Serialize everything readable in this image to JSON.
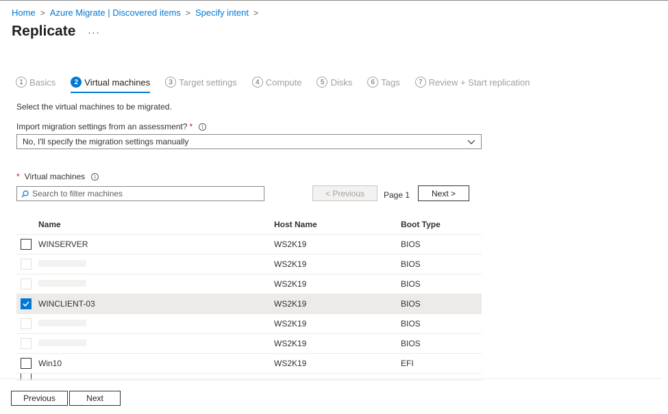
{
  "breadcrumb": [
    "Home",
    "Azure Migrate | Discovered items",
    "Specify intent"
  ],
  "title": "Replicate",
  "more_label": "···",
  "steps": [
    {
      "num": "1",
      "label": "Basics",
      "active": false
    },
    {
      "num": "2",
      "label": "Virtual machines",
      "active": true
    },
    {
      "num": "3",
      "label": "Target settings",
      "active": false
    },
    {
      "num": "4",
      "label": "Compute",
      "active": false
    },
    {
      "num": "5",
      "label": "Disks",
      "active": false
    },
    {
      "num": "6",
      "label": "Tags",
      "active": false
    },
    {
      "num": "7",
      "label": "Review + Start replication",
      "active": false
    }
  ],
  "description": "Select the virtual machines to be migrated.",
  "import_label": "Import migration settings from an assessment?",
  "required_mark": "*",
  "info_glyph": "i",
  "import_value": "No, I'll specify the migration settings manually",
  "vm_label": "Virtual machines",
  "search_placeholder": "Search to filter machines",
  "pager": {
    "previous": "< Previous",
    "page": "Page 1",
    "next": "Next >"
  },
  "table": {
    "headers": {
      "name": "Name",
      "host": "Host Name",
      "boot": "Boot Type"
    },
    "rows": [
      {
        "name": "WINSERVER",
        "host": "WS2K19",
        "boot": "BIOS",
        "checked": false,
        "blurred": false
      },
      {
        "name": "",
        "host": "WS2K19",
        "boot": "BIOS",
        "checked": false,
        "blurred": true
      },
      {
        "name": "",
        "host": "WS2K19",
        "boot": "BIOS",
        "checked": false,
        "blurred": true
      },
      {
        "name": "WINCLIENT-03",
        "host": "WS2K19",
        "boot": "BIOS",
        "checked": true,
        "blurred": false
      },
      {
        "name": "",
        "host": "WS2K19",
        "boot": "BIOS",
        "checked": false,
        "blurred": true
      },
      {
        "name": "",
        "host": "WS2K19",
        "boot": "BIOS",
        "checked": false,
        "blurred": true
      },
      {
        "name": "Win10",
        "host": "WS2K19",
        "boot": "EFI",
        "checked": false,
        "blurred": false
      }
    ]
  },
  "footer": {
    "previous": "Previous",
    "next": "Next"
  },
  "colors": {
    "accent": "#0078d4",
    "required": "#a4262c"
  }
}
